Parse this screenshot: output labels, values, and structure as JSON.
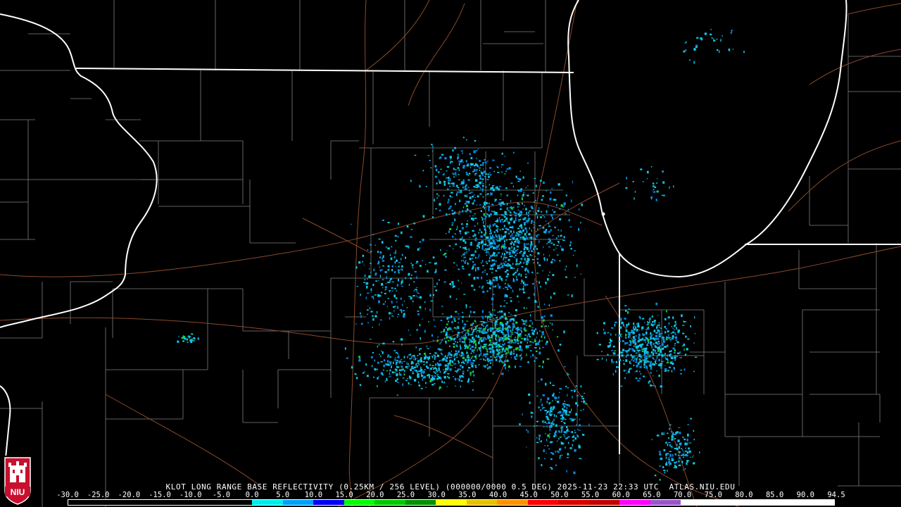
{
  "product": {
    "caption": "KLOT LONG RANGE BASE REFLECTIVITY (0.25KM / 256 LEVEL) (000000/0000 0.5 DEG) 2025-11-23 22:33 UTC  ATLAS.NIU.EDU"
  },
  "scale": {
    "labels": [
      "-30.0",
      "-25.0",
      "-20.0",
      "-15.0",
      "-10.0",
      "-5.0",
      "0.0",
      "5.0",
      "10.0",
      "15.0",
      "20.0",
      "25.0",
      "30.0",
      "35.0",
      "40.0",
      "45.0",
      "50.0",
      "55.0",
      "60.0",
      "65.0",
      "70.0",
      "75.0",
      "80.0",
      "85.0",
      "90.0",
      "94.5"
    ],
    "colors": [
      "#000000",
      "#000000",
      "#000000",
      "#000000",
      "#000000",
      "#000000",
      "#00ecec",
      "#01a0f6",
      "#0000f6",
      "#00ff00",
      "#00c800",
      "#009000",
      "#ffff00",
      "#e7c000",
      "#ff9000",
      "#ff0000",
      "#d60000",
      "#c00000",
      "#ff00ff",
      "#9955c9",
      "#ffffff",
      "#ffffff",
      "#ffffff",
      "#ffffff",
      "#ffffff"
    ]
  },
  "logo": {
    "text": "NIU",
    "colors": {
      "mark": "#c8102e",
      "band": "#ffffff"
    }
  },
  "map": {
    "colors": {
      "background": "#000000",
      "county_line": "#7f7f7f",
      "state_line": "#ffffff",
      "highway": "#8b4a2b",
      "echo_light": "#11c6e6",
      "echo_medium": "#0a8be0",
      "echo_strong": "#1ecf3a"
    }
  }
}
